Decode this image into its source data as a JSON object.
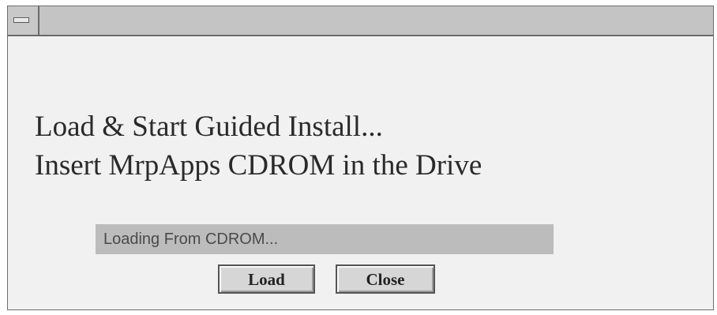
{
  "dialog": {
    "message_line1": "Load & Start Guided Install...",
    "message_line2": "Insert MrpApps CDROM in the Drive",
    "status_text": "Loading From CDROM...",
    "progress_fraction": 0.0,
    "buttons": {
      "load_label": "Load",
      "close_label": "Close"
    }
  },
  "icons": {
    "window_menu": "window-menu-icon"
  },
  "colors": {
    "window_background": "#f1f1f1",
    "titlebar": "#c4c4c4",
    "status_bar": "#bcbcbc",
    "button_face": "#d6d6d6",
    "text": "#2a2a2a"
  }
}
